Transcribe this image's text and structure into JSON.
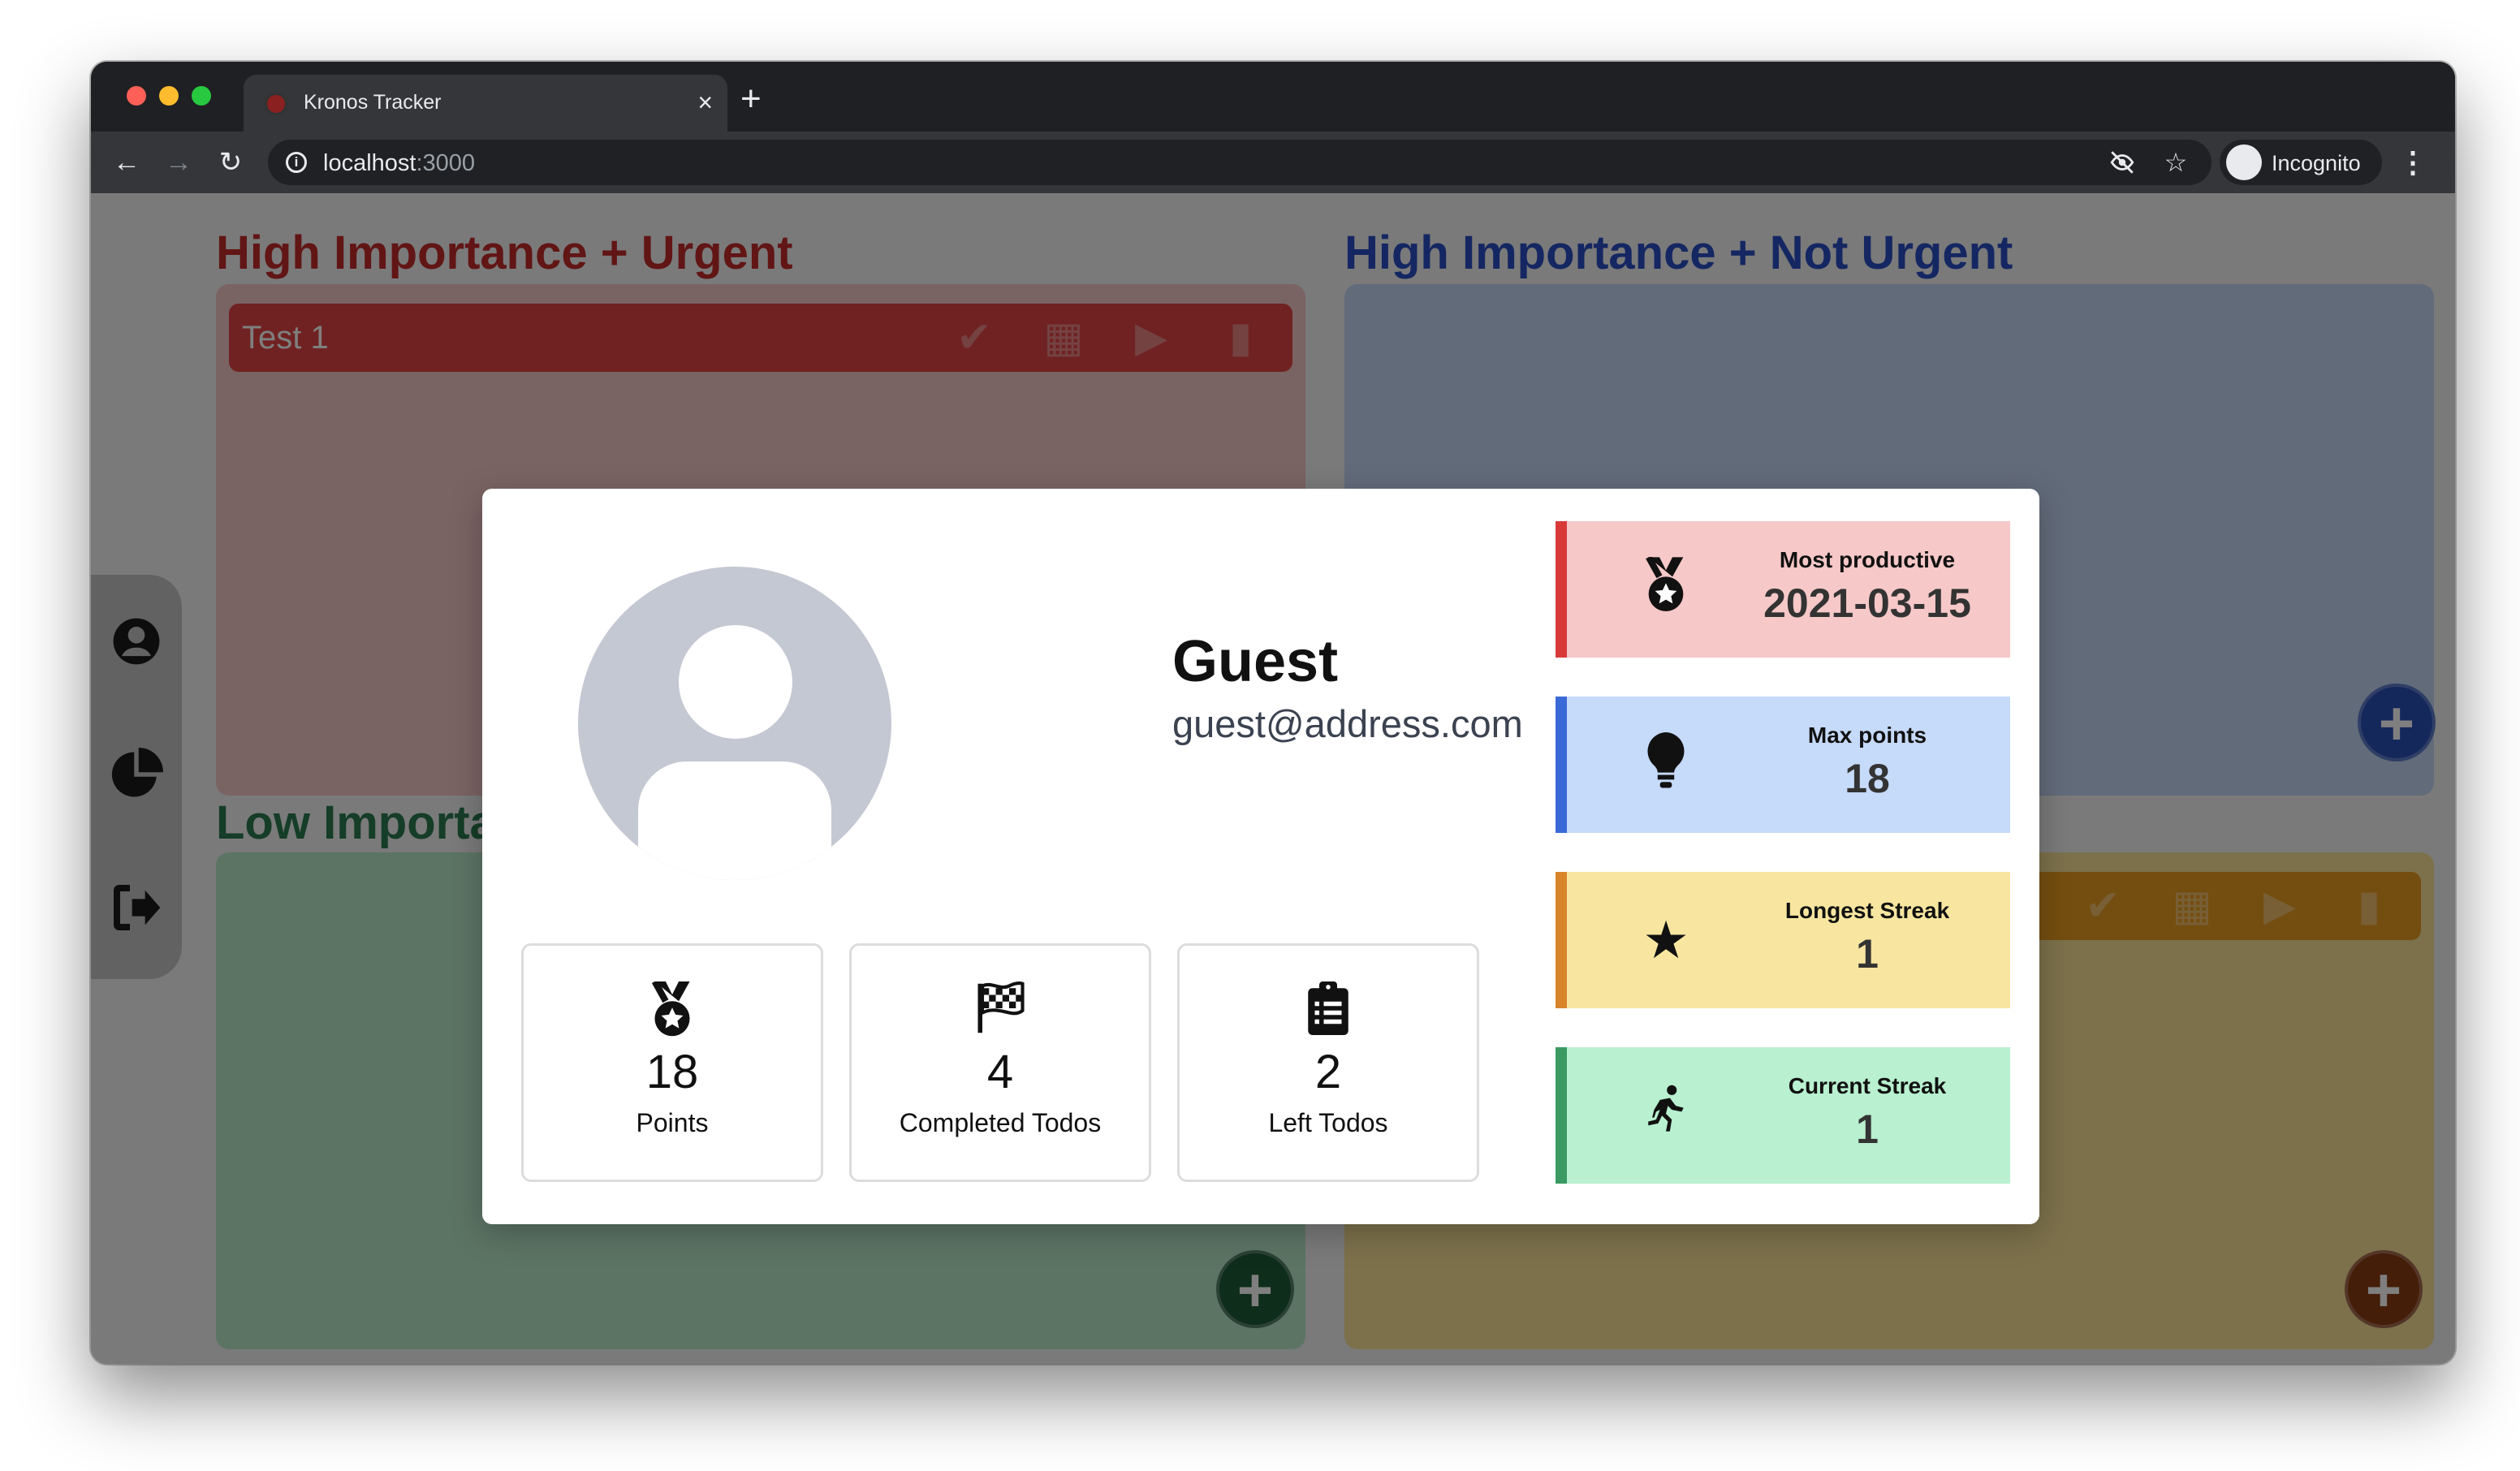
{
  "browser": {
    "tab_title": "Kronos Tracker",
    "tab_close": "×",
    "new_tab": "+",
    "url_host": "localhost",
    "url_port": ":3000",
    "profile_label": "Incognito"
  },
  "quadrants": {
    "q1_title": "High Importance + Urgent",
    "q2_title": "High Importance + Not Urgent",
    "q3_title": "Low Importa",
    "q1_todo": "Test 1"
  },
  "profile": {
    "name": "Guest",
    "email": "guest@address.com"
  },
  "stats": [
    {
      "icon": "medal-icon",
      "value": "18",
      "label": "Points"
    },
    {
      "icon": "checkered-flag-icon",
      "value": "4",
      "label": "Completed Todos"
    },
    {
      "icon": "clipboard-list-icon",
      "value": "2",
      "label": "Left Todos"
    }
  ],
  "records": [
    {
      "icon": "medal-icon",
      "label": "Most productive",
      "value": "2021-03-15",
      "color": "#d83a3a"
    },
    {
      "icon": "lightbulb-icon",
      "label": "Max points",
      "value": "18",
      "color": "#3a6ad8"
    },
    {
      "icon": "star-icon",
      "label": "Longest Streak",
      "value": "1",
      "color": "#d8852a"
    },
    {
      "icon": "running-icon",
      "label": "Current Streak",
      "value": "1",
      "color": "#3a9a62"
    }
  ]
}
